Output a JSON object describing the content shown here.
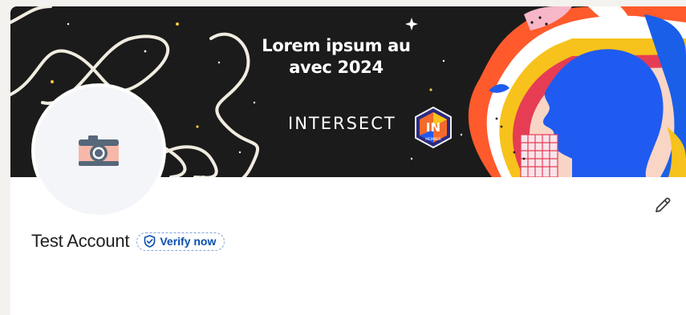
{
  "banner": {
    "headline_line1": "Lorem ipsum au",
    "headline_line2": "avec 2024",
    "brand": "INTERSECT",
    "badge_text": "IN",
    "badge_sub": "MEMBER"
  },
  "profile": {
    "name": "Test Account",
    "verify_label": "Verify now",
    "avatar_icon": "camera-icon",
    "edit_icon": "pencil-icon"
  },
  "colors": {
    "banner_bg": "#1b1b1b",
    "verify_text": "#0a4fae",
    "verify_border": "#7ea3d6",
    "page_bg": "#f4f2ee"
  }
}
